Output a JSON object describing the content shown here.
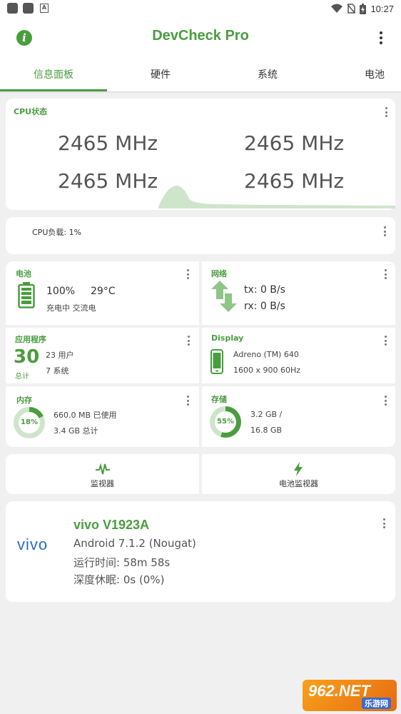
{
  "status_bar": {
    "time": "10:27"
  },
  "app": {
    "title": "DevCheck Pro"
  },
  "tabs": [
    {
      "label": "信息面板"
    },
    {
      "label": "硬件"
    },
    {
      "label": "系统"
    },
    {
      "label": "电池"
    }
  ],
  "cpu": {
    "title": "CPU状态",
    "freqs": [
      "2465 MHz",
      "2465 MHz",
      "2465 MHz",
      "2465 MHz"
    ]
  },
  "cpu_load": {
    "label": "CPU负载: 1%"
  },
  "battery": {
    "title": "电池",
    "level": "100%",
    "temp": "29°C",
    "status": "充电中 交流电"
  },
  "network": {
    "title": "网络",
    "tx": "tx: 0 B/s",
    "rx": "rx: 0 B/s"
  },
  "apps": {
    "title": "应用程序",
    "total": "30",
    "total_label": "总计",
    "user": "23 用户",
    "system": "7 系统"
  },
  "display": {
    "title": "Display",
    "gpu": "Adreno (TM) 640",
    "resolution": "1600 x 900  60Hz"
  },
  "memory": {
    "title": "内存",
    "percent": "18%",
    "used": "660.0 MB 已使用",
    "total": "3.4 GB 总计"
  },
  "storage": {
    "title": "存储",
    "percent": "55%",
    "used": "3.2 GB /",
    "total": "16.8 GB"
  },
  "actions": {
    "monitor": "监视器",
    "battery_monitor": "电池监视器"
  },
  "device": {
    "brand_logo": "vivo",
    "model": "vivo V1923A",
    "android": "Android 7.1.2 (Nougat)",
    "uptime": "运行时间: 58m 58s",
    "deep_sleep": "深度休眠: 0s (0%)"
  },
  "watermark": {
    "text": "962.NET",
    "sub": "乐游网"
  },
  "colors": {
    "accent": "#4a9d3f",
    "vivo_blue": "#2b6cc4"
  }
}
